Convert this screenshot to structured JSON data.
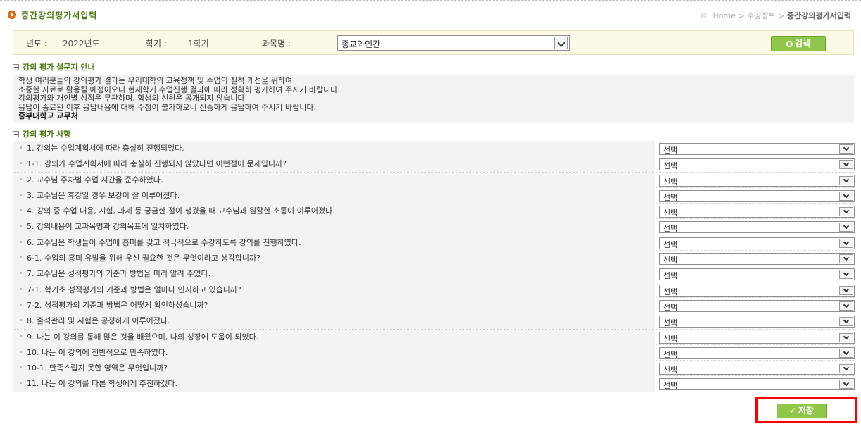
{
  "header": {
    "title": "중간강의평가서입력",
    "breadcrumb": [
      "Home",
      ">",
      "수강정보",
      ">",
      "중간강의평가서입력"
    ]
  },
  "search": {
    "year_label": "년도 :",
    "year_value": "2022년도",
    "semester_label": "학기 :",
    "semester_value": "1학기",
    "course_label": "과목명 :",
    "course_value": "종교와인간",
    "button_label": "검색"
  },
  "notice": {
    "heading": "강의 평가 설문지 안내",
    "lines": [
      "학생 여러분들의 강의평가 결과는 우리대학의 교육정책 및 수업의 질적 개선을 위하여",
      "소중한 자료로 활용될 예정이오니 현재학기 수업진행 결과에 따라 정확히 평가하여 주시기 바랍니다.",
      "강의평가와 개인별 성적은 무관하며, 학생의 신원은 공개되지 않습니다",
      "응답이 종료된 이후 응답내용에 대해 수정이 불가하오니 신중하게 응답하여 주시기 바랍니다."
    ],
    "signature": "중부대학교 교무처"
  },
  "evaluation": {
    "heading": "강의 평가 사항",
    "select_placeholder": "선택",
    "questions": [
      "1. 강의는 수업계획서에 따라 충실히 진행되었다.",
      "1-1. 강의가 수업계획서에 따라 충실히 진행되지 않았다면 어떤점이 문제입니까?",
      "2. 교수님 주차별 수업 시간을 준수하였다.",
      "3. 교수님은 휴강일 경우 보강이 잘 이루어졌다.",
      "4. 강의 중 수업 내용, 시험, 과제 등 궁금한 점이 생겼을 때 교수님과 원활한 소통이 이루어졌다.",
      "5. 강의내용이 교과목명과 강의목표에 일치하였다.",
      "6. 교수님은 학생들이 수업에 흥미를 갖고 적극적으로 수강하도록 강의를 진행하였다.",
      "6-1. 수업의 흥미 유발을 위해 우선 필요한 것은 무엇이라고 생각합니까?",
      "7. 교수님은 성적평가의 기준과 방법을 미리 알려 주었다.",
      "7-1. 학기초 성적평가의 기준과 방법은 얼마나 인지하고 있습니까?",
      "7-2. 성적평가의 기준과 방법은 어떻게 확인하셨습니까?",
      "8. 출석관리 및 시험은 공정하게 이루어졌다.",
      "9. 나는 이 강의를 통해 많은 것을 배웠으며, 나의 성장에 도움이 되었다.",
      "10. 나는 이 강의에 전반적으로 만족하였다.",
      "10-1. 만족스럽지 못한 영역은 무엇입니까?",
      "11. 나는 이 강의를 다른 학생에게 추천하겠다."
    ]
  },
  "save_button": "저장",
  "colors": {
    "accent_green": "#8fc74a",
    "heading_green": "#4d7a10",
    "highlight_red": "#ff0000"
  }
}
